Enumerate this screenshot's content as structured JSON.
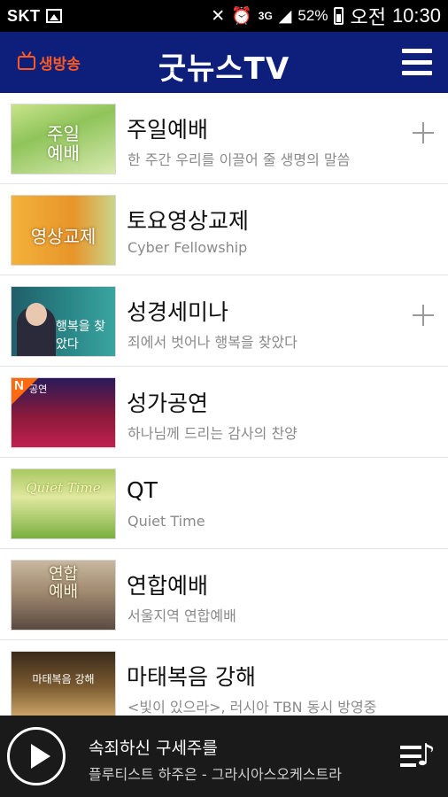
{
  "status_bar": {
    "carrier": "SKT",
    "battery_percent": "52%",
    "ampm": "오전",
    "time": "10:30",
    "network": "3G"
  },
  "header": {
    "live_label": "생방송",
    "title": "굿뉴스TV"
  },
  "list": [
    {
      "title": "주일예배",
      "subtitle": "한 주간 우리를 이끌어 줄 생명의 말씀",
      "thumb_text": "주일\n예배",
      "expandable": true
    },
    {
      "title": "토요영상교제",
      "subtitle": "Cyber Fellowship",
      "thumb_text": "영상교제",
      "expandable": false
    },
    {
      "title": "성경세미나",
      "subtitle": "죄에서 벗어나 행복을 찾았다",
      "thumb_text": "행복을 찾았다",
      "expandable": true
    },
    {
      "title": "성가공연",
      "subtitle": "하나님께 드리는 감사의 찬양",
      "thumb_text": "공연",
      "expandable": false
    },
    {
      "title": "QT",
      "subtitle": "Quiet Time",
      "thumb_text": "Quiet Time",
      "expandable": false
    },
    {
      "title": "연합예배",
      "subtitle": "서울지역 연합예배",
      "thumb_text": "연합\n예배",
      "expandable": false
    },
    {
      "title": "마태복음 강해",
      "subtitle": "<빛이 있으라>, 러시아 TBN 동시 방영중",
      "thumb_text": "마태복음 강해",
      "expandable": false
    }
  ],
  "player": {
    "song_title": "속죄하신 구세주를",
    "artist": "플루티스트 하주은 - 그라시아스오케스트라"
  },
  "colors": {
    "header_bg": "#0d1f7a",
    "live_accent": "#ff5a1f",
    "player_bg": "#1a1a1a"
  }
}
